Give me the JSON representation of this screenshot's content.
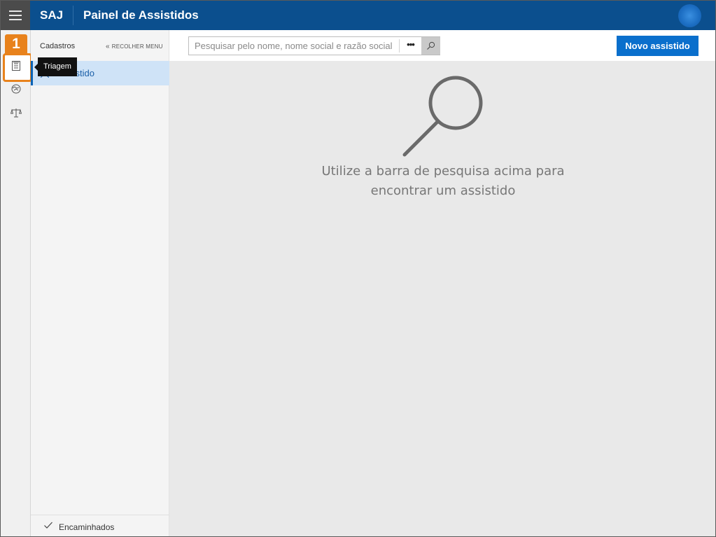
{
  "header": {
    "brand": "SAJ",
    "title": "Painel de Assistidos"
  },
  "annotation": {
    "step": "1"
  },
  "rail": {
    "items": [
      {
        "icon": "checklist-icon"
      },
      {
        "icon": "handshake-icon"
      },
      {
        "icon": "scales-icon"
      }
    ],
    "tooltip": "Triagem"
  },
  "sidemenu": {
    "header": "Cadastros",
    "collapse_label": "RECOLHER MENU",
    "items": [
      {
        "label": "Assistido",
        "icon": "user-icon",
        "active": true
      }
    ],
    "footer_label": "Encaminhados"
  },
  "search": {
    "placeholder": "Pesquisar pelo nome, nome social e razão social",
    "value": "",
    "more_label": "•••"
  },
  "actions": {
    "new_label": "Novo assistido"
  },
  "empty_state": {
    "line1": "Utilize a barra de pesquisa acima para",
    "line2": "encontrar um assistido"
  },
  "colors": {
    "header": "#0b4f8e",
    "accent": "#0a6fcc",
    "highlight": "#e8821c"
  }
}
